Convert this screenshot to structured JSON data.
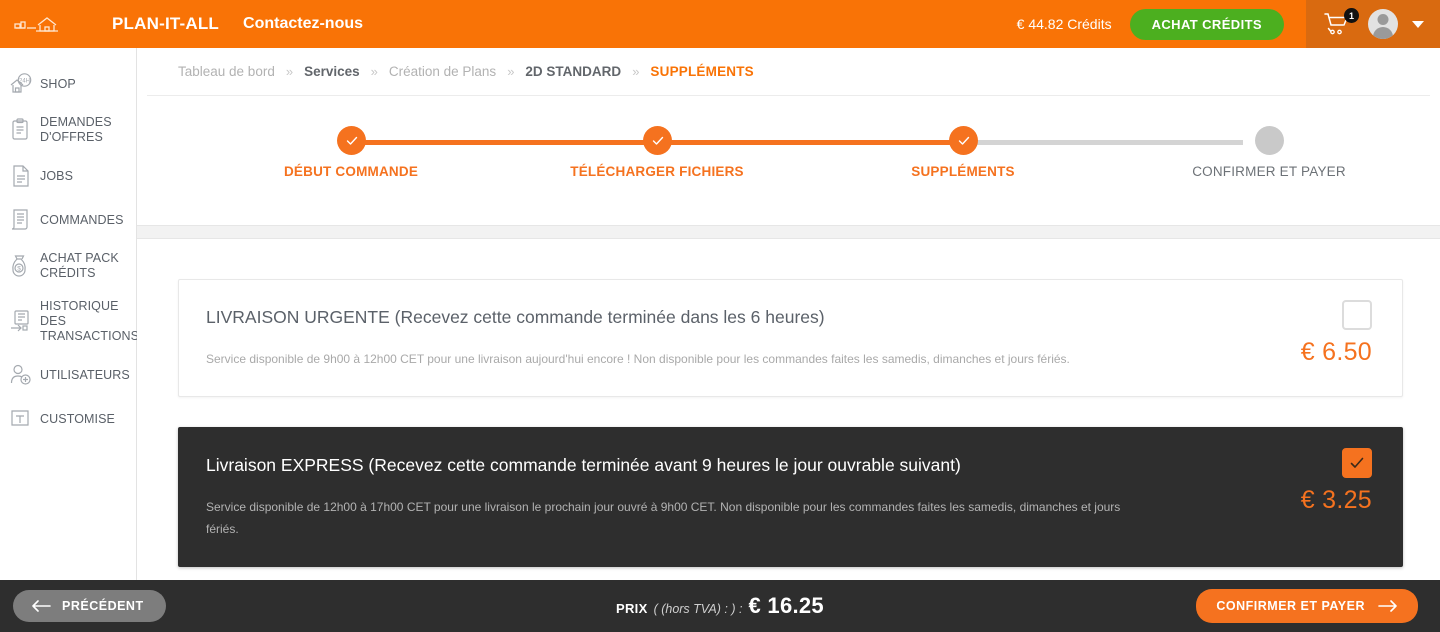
{
  "header": {
    "logo_icon": "house-blueprint-icon",
    "brand": "PLAN-IT-ALL",
    "contact_link": "Contactez-nous",
    "credits": "€ 44.82 Crédits",
    "buy_credits_label": "ACHAT CRÉDITS",
    "cart_icon": "shopping-cart-icon",
    "cart_count": "1",
    "avatar_icon": "user-avatar-icon",
    "caret_icon": "chevron-down-icon",
    "brand_color": "#f97306",
    "buy_button_color": "#4caf1f",
    "right_panel_color": "#d96a10"
  },
  "sidebar": {
    "items": [
      {
        "label": "SHOP",
        "icon": "shop-24h-icon"
      },
      {
        "label": "DEMANDES D'OFFRES",
        "icon": "clipboard-icon"
      },
      {
        "label": "JOBS",
        "icon": "document-icon"
      },
      {
        "label": "COMMANDES",
        "icon": "orders-list-icon"
      },
      {
        "label": "ACHAT PACK CRÉDITS",
        "icon": "money-bag-icon"
      },
      {
        "label": "HISTORIQUE DES TRANSACTIONS",
        "icon": "transaction-history-icon"
      },
      {
        "label": "UTILISATEURS",
        "icon": "add-user-icon"
      },
      {
        "label": "CUSTOMISE",
        "icon": "customise-icon"
      }
    ]
  },
  "breadcrumb": {
    "items": [
      {
        "label": "Tableau de bord",
        "style": "dim"
      },
      {
        "label": "Services",
        "style": "strong"
      },
      {
        "label": "Création de Plans",
        "style": "dim"
      },
      {
        "label": "2D STANDARD",
        "style": "strong"
      },
      {
        "label": "SUPPLÉMENTS",
        "style": "current"
      }
    ],
    "separator": "»"
  },
  "stepper": {
    "steps": [
      {
        "label": "DÉBUT COMMANDE",
        "state": "done"
      },
      {
        "label": "TÉLÉCHARGER FICHIERS",
        "state": "done"
      },
      {
        "label": "SUPPLÉMENTS",
        "state": "done"
      },
      {
        "label": "CONFIRMER ET PAYER",
        "state": "pending"
      }
    ],
    "done_color": "#f5721f",
    "pending_color": "#c9c9c9"
  },
  "options": [
    {
      "title": "LIVRAISON URGENTE (Recevez cette commande terminée dans les 6 heures)",
      "description": "Service disponible de 9h00 à 12h00 CET pour une livraison aujourd'hui encore ! Non disponible pour les commandes faites les samedis, dimanches et jours fériés.",
      "price": "€ 6.50",
      "selected": false
    },
    {
      "title": "Livraison EXPRESS (Recevez cette commande terminée avant 9 heures le jour ouvrable suivant)",
      "description": "Service disponible de 12h00 à 17h00 CET pour une livraison le prochain jour ouvré à 9h00 CET. Non disponible pour les commandes faites les samedis, dimanches et jours fériés.",
      "price": "€ 3.25",
      "selected": true
    }
  ],
  "footer": {
    "previous_label": "PRÉCÉDENT",
    "price_label": "PRIX",
    "price_note": "( (hors TVA) : ) :",
    "price_value": "€ 16.25",
    "confirm_label": "CONFIRMER ET PAYER",
    "accent_color": "#f5721f",
    "background": "#2e2e2e"
  }
}
